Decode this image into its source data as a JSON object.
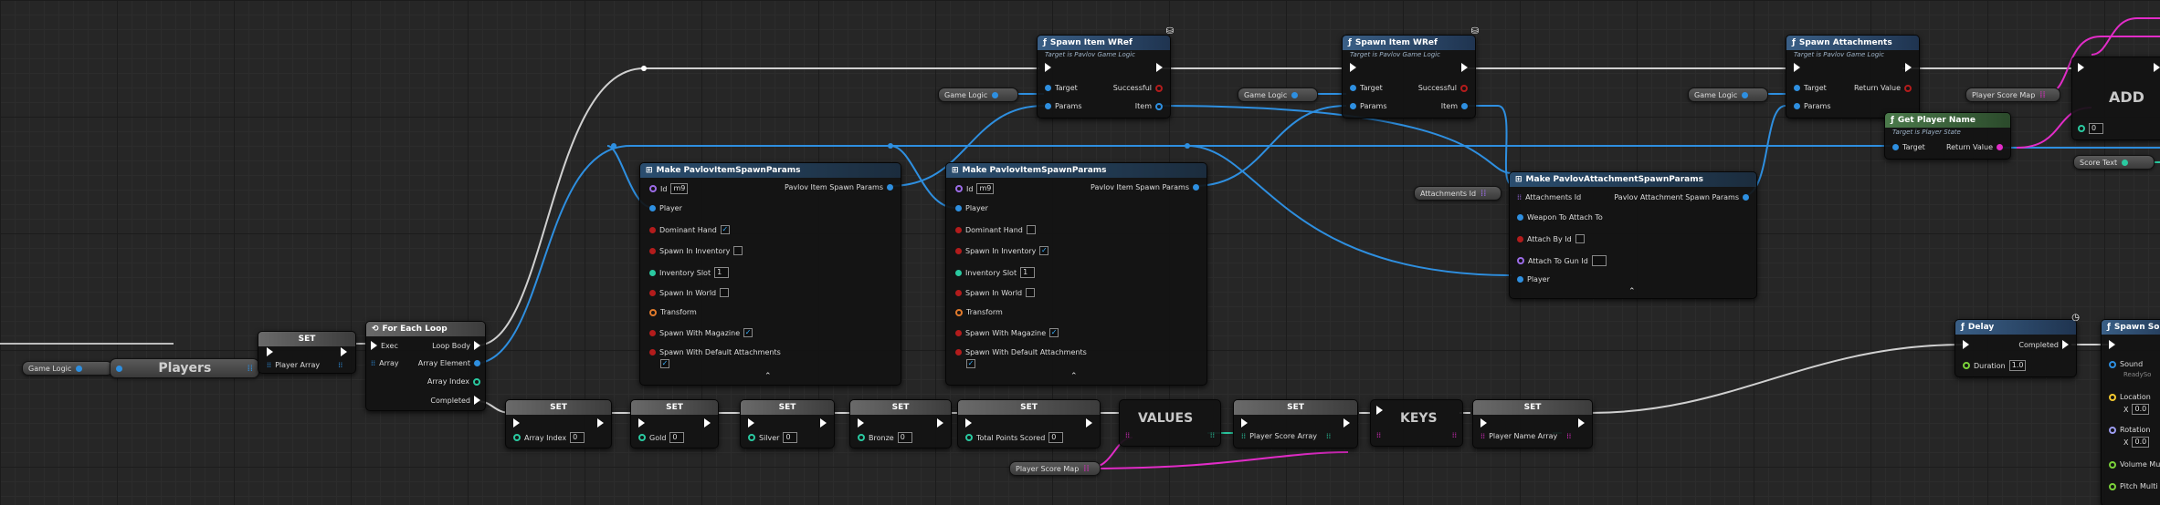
{
  "canvas": {
    "label": "Blueprint Event Graph"
  },
  "colors": {
    "exec_wire": "#d0d0d0",
    "object_wire": "#2e8fe0",
    "struct_wire": "#2e8fe0",
    "map_wire": "#e22cc8",
    "int_wire": "#2ac9a0"
  },
  "vars": {
    "game_logic_1": "Game Logic",
    "players": "Players",
    "game_logic_2": "Game Logic",
    "game_logic_3": "Game Logic",
    "game_logic_4": "Game Logic",
    "player_score_map_1": "Player Score Map",
    "player_score_map_2": "Player Score Map",
    "attachments_id": "Attachments Id",
    "score_text": "Score Text"
  },
  "set_players": {
    "title": "SET",
    "pin": "Player Array"
  },
  "for_each": {
    "title": "For Each Loop",
    "exec": "Exec",
    "array": "Array",
    "loop_body": "Loop Body",
    "array_element": "Array Element",
    "array_index": "Array Index",
    "completed": "Completed"
  },
  "make1": {
    "title": "Make PavlovItemSpawnParams",
    "id_label": "Id",
    "id_value": "m9",
    "output": "Pavlov Item Spawn Params",
    "player": "Player",
    "dominant_hand": "Dominant Hand",
    "dominant_hand_checked": "✓",
    "spawn_in_inventory": "Spawn In Inventory",
    "spawn_in_inventory_checked": "",
    "inventory_slot": "Inventory Slot",
    "inventory_slot_value": "1",
    "spawn_in_world": "Spawn In World",
    "transform": "Transform",
    "spawn_with_magazine": "Spawn With Magazine",
    "spawn_with_magazine_checked": "✓",
    "spawn_with_default_attachments": "Spawn With Default Attachments",
    "spawn_with_default_attachments_checked": "✓"
  },
  "make2": {
    "title": "Make PavlovItemSpawnParams",
    "id_label": "Id",
    "id_value": "m9",
    "output": "Pavlov Item Spawn Params",
    "player": "Player",
    "dominant_hand": "Dominant Hand",
    "dominant_hand_checked": "",
    "spawn_in_inventory": "Spawn In Inventory",
    "spawn_in_inventory_checked": "✓",
    "inventory_slot": "Inventory Slot",
    "inventory_slot_value": "1",
    "spawn_in_world": "Spawn In World",
    "transform": "Transform",
    "spawn_with_magazine": "Spawn With Magazine",
    "spawn_with_magazine_checked": "✓",
    "spawn_with_default_attachments": "Spawn With Default Attachments",
    "spawn_with_default_attachments_checked": "✓"
  },
  "spawn1": {
    "title": "Spawn Item WRef",
    "subtitle": "Target is Pavlov Game Logic",
    "target": "Target",
    "params": "Params",
    "successful": "Successful",
    "item": "Item"
  },
  "spawn2": {
    "title": "Spawn Item WRef",
    "subtitle": "Target is Pavlov Game Logic",
    "target": "Target",
    "params": "Params",
    "successful": "Successful",
    "item": "Item"
  },
  "spawn_att": {
    "title": "Spawn Attachments",
    "subtitle": "Target is Pavlov Game Logic",
    "target": "Target",
    "params": "Params",
    "return_value": "Return Value"
  },
  "make_att": {
    "title": "Make PavlovAttachmentSpawnParams",
    "attachments_id": "Attachments Id",
    "output": "Pavlov Attachment Spawn Params",
    "weapon_to_attach_to": "Weapon To Attach To",
    "attach_by_id": "Attach By Id",
    "attach_to_gun_id": "Attach To Gun Id",
    "player": "Player"
  },
  "get_player_name": {
    "title": "Get Player Name",
    "subtitle": "Target is Player State",
    "target": "Target",
    "return_value": "Return Value"
  },
  "add": {
    "title": "ADD",
    "index_value": "0"
  },
  "sets": [
    {
      "title": "SET",
      "label": "Array Index",
      "value": "0"
    },
    {
      "title": "SET",
      "label": "Gold",
      "value": "0"
    },
    {
      "title": "SET",
      "label": "Silver",
      "value": "0"
    },
    {
      "title": "SET",
      "label": "Bronze",
      "value": "0"
    },
    {
      "title": "SET",
      "label": "Total Points Scored",
      "value": "0"
    }
  ],
  "values_node": {
    "title": "VALUES"
  },
  "set_score": {
    "title": "SET",
    "label": "Player Score Array"
  },
  "keys_node": {
    "title": "KEYS"
  },
  "set_name": {
    "title": "SET",
    "label": "Player Name Array"
  },
  "delay": {
    "title": "Delay",
    "completed": "Completed",
    "duration": "Duration",
    "duration_value": "1.0"
  },
  "spawn_sound": {
    "title": "Spawn Sou",
    "sound": "Sound",
    "sound_value": "ReadySo",
    "location": "Location",
    "rotation": "Rotation",
    "volume": "Volume Mu",
    "pitch": "Pitch Multi",
    "vec_x": "X",
    "vec_value": "0.0"
  }
}
